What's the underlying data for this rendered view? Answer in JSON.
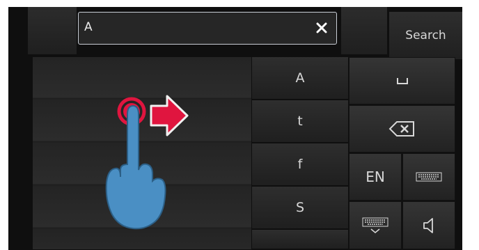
{
  "search": {
    "value": "A",
    "button_label": "Search"
  },
  "suggestions": [
    "A",
    "t",
    "f",
    "S"
  ],
  "keys": {
    "language": "EN",
    "space": "space-icon",
    "backspace": "backspace-icon",
    "keyboard": "keyboard-icon",
    "hide_keyboard": "keyboard-hide-icon",
    "sound": "speaker-icon"
  },
  "colors": {
    "accent": "#e0153f",
    "hand": "#4a8fc4",
    "field_border": "#c9ced6"
  }
}
